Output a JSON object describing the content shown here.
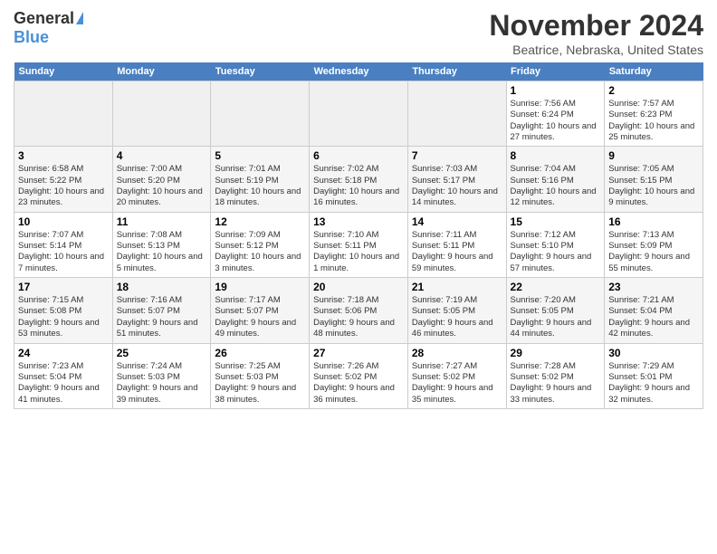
{
  "header": {
    "logo_general": "General",
    "logo_blue": "Blue",
    "month_title": "November 2024",
    "location": "Beatrice, Nebraska, United States"
  },
  "calendar": {
    "headers": [
      "Sunday",
      "Monday",
      "Tuesday",
      "Wednesday",
      "Thursday",
      "Friday",
      "Saturday"
    ],
    "weeks": [
      [
        {
          "day": "",
          "info": ""
        },
        {
          "day": "",
          "info": ""
        },
        {
          "day": "",
          "info": ""
        },
        {
          "day": "",
          "info": ""
        },
        {
          "day": "",
          "info": ""
        },
        {
          "day": "1",
          "info": "Sunrise: 7:56 AM\nSunset: 6:24 PM\nDaylight: 10 hours and 27 minutes."
        },
        {
          "day": "2",
          "info": "Sunrise: 7:57 AM\nSunset: 6:23 PM\nDaylight: 10 hours and 25 minutes."
        }
      ],
      [
        {
          "day": "3",
          "info": "Sunrise: 6:58 AM\nSunset: 5:22 PM\nDaylight: 10 hours and 23 minutes."
        },
        {
          "day": "4",
          "info": "Sunrise: 7:00 AM\nSunset: 5:20 PM\nDaylight: 10 hours and 20 minutes."
        },
        {
          "day": "5",
          "info": "Sunrise: 7:01 AM\nSunset: 5:19 PM\nDaylight: 10 hours and 18 minutes."
        },
        {
          "day": "6",
          "info": "Sunrise: 7:02 AM\nSunset: 5:18 PM\nDaylight: 10 hours and 16 minutes."
        },
        {
          "day": "7",
          "info": "Sunrise: 7:03 AM\nSunset: 5:17 PM\nDaylight: 10 hours and 14 minutes."
        },
        {
          "day": "8",
          "info": "Sunrise: 7:04 AM\nSunset: 5:16 PM\nDaylight: 10 hours and 12 minutes."
        },
        {
          "day": "9",
          "info": "Sunrise: 7:05 AM\nSunset: 5:15 PM\nDaylight: 10 hours and 9 minutes."
        }
      ],
      [
        {
          "day": "10",
          "info": "Sunrise: 7:07 AM\nSunset: 5:14 PM\nDaylight: 10 hours and 7 minutes."
        },
        {
          "day": "11",
          "info": "Sunrise: 7:08 AM\nSunset: 5:13 PM\nDaylight: 10 hours and 5 minutes."
        },
        {
          "day": "12",
          "info": "Sunrise: 7:09 AM\nSunset: 5:12 PM\nDaylight: 10 hours and 3 minutes."
        },
        {
          "day": "13",
          "info": "Sunrise: 7:10 AM\nSunset: 5:11 PM\nDaylight: 10 hours and 1 minute."
        },
        {
          "day": "14",
          "info": "Sunrise: 7:11 AM\nSunset: 5:11 PM\nDaylight: 9 hours and 59 minutes."
        },
        {
          "day": "15",
          "info": "Sunrise: 7:12 AM\nSunset: 5:10 PM\nDaylight: 9 hours and 57 minutes."
        },
        {
          "day": "16",
          "info": "Sunrise: 7:13 AM\nSunset: 5:09 PM\nDaylight: 9 hours and 55 minutes."
        }
      ],
      [
        {
          "day": "17",
          "info": "Sunrise: 7:15 AM\nSunset: 5:08 PM\nDaylight: 9 hours and 53 minutes."
        },
        {
          "day": "18",
          "info": "Sunrise: 7:16 AM\nSunset: 5:07 PM\nDaylight: 9 hours and 51 minutes."
        },
        {
          "day": "19",
          "info": "Sunrise: 7:17 AM\nSunset: 5:07 PM\nDaylight: 9 hours and 49 minutes."
        },
        {
          "day": "20",
          "info": "Sunrise: 7:18 AM\nSunset: 5:06 PM\nDaylight: 9 hours and 48 minutes."
        },
        {
          "day": "21",
          "info": "Sunrise: 7:19 AM\nSunset: 5:05 PM\nDaylight: 9 hours and 46 minutes."
        },
        {
          "day": "22",
          "info": "Sunrise: 7:20 AM\nSunset: 5:05 PM\nDaylight: 9 hours and 44 minutes."
        },
        {
          "day": "23",
          "info": "Sunrise: 7:21 AM\nSunset: 5:04 PM\nDaylight: 9 hours and 42 minutes."
        }
      ],
      [
        {
          "day": "24",
          "info": "Sunrise: 7:23 AM\nSunset: 5:04 PM\nDaylight: 9 hours and 41 minutes."
        },
        {
          "day": "25",
          "info": "Sunrise: 7:24 AM\nSunset: 5:03 PM\nDaylight: 9 hours and 39 minutes."
        },
        {
          "day": "26",
          "info": "Sunrise: 7:25 AM\nSunset: 5:03 PM\nDaylight: 9 hours and 38 minutes."
        },
        {
          "day": "27",
          "info": "Sunrise: 7:26 AM\nSunset: 5:02 PM\nDaylight: 9 hours and 36 minutes."
        },
        {
          "day": "28",
          "info": "Sunrise: 7:27 AM\nSunset: 5:02 PM\nDaylight: 9 hours and 35 minutes."
        },
        {
          "day": "29",
          "info": "Sunrise: 7:28 AM\nSunset: 5:02 PM\nDaylight: 9 hours and 33 minutes."
        },
        {
          "day": "30",
          "info": "Sunrise: 7:29 AM\nSunset: 5:01 PM\nDaylight: 9 hours and 32 minutes."
        }
      ]
    ]
  }
}
